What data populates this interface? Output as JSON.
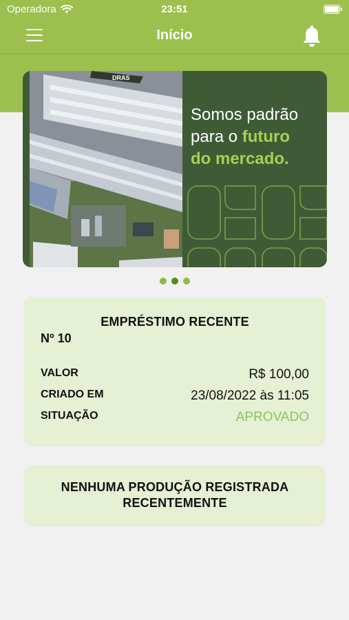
{
  "status_bar": {
    "carrier": "Operadora",
    "time": "23:51"
  },
  "header": {
    "title": "Início"
  },
  "banner": {
    "line1": "Somos padrão",
    "line2_prefix": "para o ",
    "line2_highlight": "futuro",
    "line3_highlight": "do mercado.",
    "photo_sign": "DRAS"
  },
  "carousel": {
    "page_count": 3,
    "active_index": 1
  },
  "loan_card": {
    "title": "EMPRÉSTIMO RECENTE",
    "number": "Nº 10",
    "rows": [
      {
        "label": "VALOR",
        "value": "R$ 100,00"
      },
      {
        "label": "CRIADO EM",
        "value": "23/08/2022 às 11:05"
      },
      {
        "label": "SITUAÇÃO",
        "value": "APROVADO"
      }
    ]
  },
  "production_card": {
    "line1": "NENHUMA PRODUÇÃO REGISTRADA",
    "line2": "RECENTEMENTE"
  },
  "colors": {
    "header_green": "#9bc04e",
    "banner_green": "#3f5b36",
    "highlight_green": "#a6cf54",
    "card_bg": "#e5f0d4",
    "approved_green": "#8ac565"
  }
}
